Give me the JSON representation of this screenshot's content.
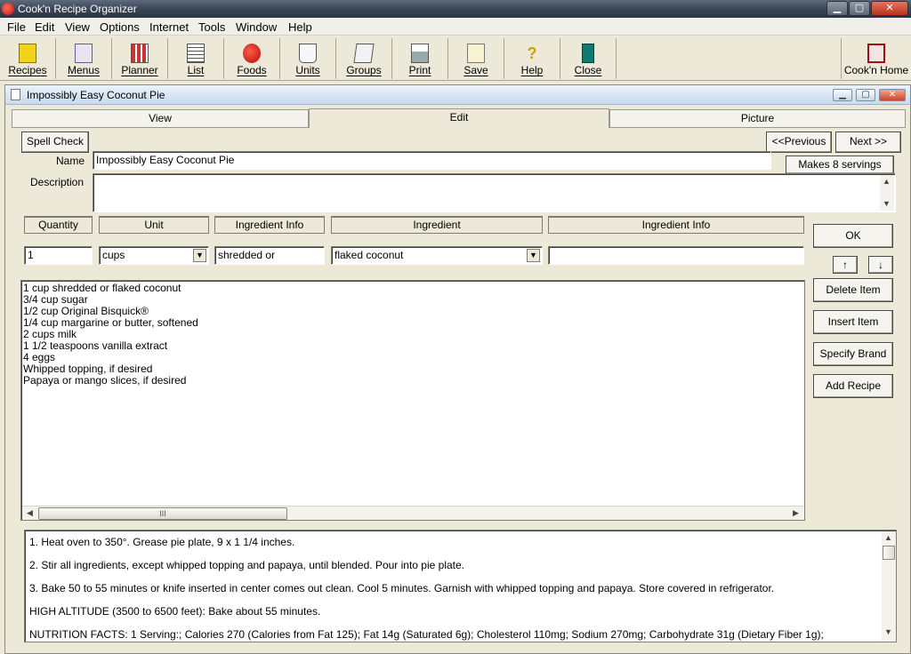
{
  "window": {
    "title": "Cook'n Recipe Organizer",
    "controls": {
      "minimize": "▁",
      "maximize": "▢",
      "close": "✕"
    }
  },
  "menu": [
    "File",
    "Edit",
    "View",
    "Options",
    "Internet",
    "Tools",
    "Window",
    "Help"
  ],
  "toolbar": {
    "items": [
      {
        "label": "Recipes",
        "icon": "recipes-icon",
        "glyph": "▤"
      },
      {
        "label": "Menus",
        "icon": "menus-icon",
        "glyph": "▥"
      },
      {
        "label": "Planner",
        "icon": "planner-icon",
        "glyph": "▦"
      },
      {
        "label": "List",
        "icon": "list-icon",
        "glyph": "☰"
      },
      {
        "label": "Foods",
        "icon": "apple-icon",
        "glyph": "●"
      },
      {
        "label": "Units",
        "icon": "measuring-cup-icon",
        "glyph": "◫"
      },
      {
        "label": "Groups",
        "icon": "groups-icon",
        "glyph": "▧"
      },
      {
        "label": "Print",
        "icon": "printer-icon",
        "glyph": "▭"
      },
      {
        "label": "Save",
        "icon": "save-icon",
        "glyph": "✚"
      },
      {
        "label": "Help",
        "icon": "help-icon",
        "glyph": "?"
      },
      {
        "label": "Close",
        "icon": "close-door-icon",
        "glyph": "▮"
      }
    ],
    "home": {
      "label": "Cook'n Home",
      "icon": "home-icon",
      "glyph": "⌂"
    }
  },
  "recipe_window": {
    "title": "Impossibly Easy Coconut Pie",
    "controls": {
      "minimize": "▁",
      "restore": "▢",
      "close": "✕"
    },
    "tabs": [
      "View",
      "Edit",
      "Picture"
    ],
    "active_tab": "Edit",
    "spell_check": "Spell Check",
    "previous": "<<Previous",
    "next": "Next >>",
    "name_label": "Name",
    "name_value": "Impossibly Easy Coconut Pie",
    "servings": "Makes 8 servings",
    "description_label": "Description",
    "description_value": "",
    "columns": [
      "Quantity",
      "Unit",
      "Ingredient Info",
      "Ingredient",
      "Ingredient Info"
    ],
    "entry": {
      "quantity": "1",
      "unit": "cups",
      "info_pre": "shredded or",
      "ingredient": "flaked coconut",
      "info_post": ""
    },
    "buttons": {
      "ok": "OK",
      "up": "↑",
      "down": "↓",
      "delete_item": "Delete Item",
      "insert_item": "Insert Item",
      "specify_brand": "Specify Brand",
      "add_recipe": "Add Recipe"
    },
    "ingredients": [
      "1 cup shredded or flaked coconut",
      "3/4 cup sugar",
      "1/2 cup Original Bisquick®",
      "1/4 cup margarine or butter, softened",
      "2 cups milk",
      "1 1/2 teaspoons vanilla extract",
      "4 eggs",
      "Whipped topping, if desired",
      "Papaya or mango slices, if desired"
    ],
    "scroll_thumb_glyph": "III",
    "directions": [
      "1. Heat oven to 350°. Grease pie plate, 9 x 1 1/4 inches.",
      "2. Stir all ingredients, except whipped topping and papaya, until blended. Pour into pie plate.",
      "3. Bake 50 to 55 minutes or knife inserted in center comes out clean. Cool 5 minutes. Garnish with whipped topping and papaya. Store covered in refrigerator.",
      "HIGH ALTITUDE (3500 to 6500 feet): Bake about 55 minutes.",
      "NUTRITION FACTS: 1 Serving:; Calories 270 (Calories from Fat 125); Fat 14g (Saturated 6g); Cholesterol 110mg; Sodium 270mg; Carbohydrate 31g (Dietary Fiber 1g);"
    ]
  }
}
